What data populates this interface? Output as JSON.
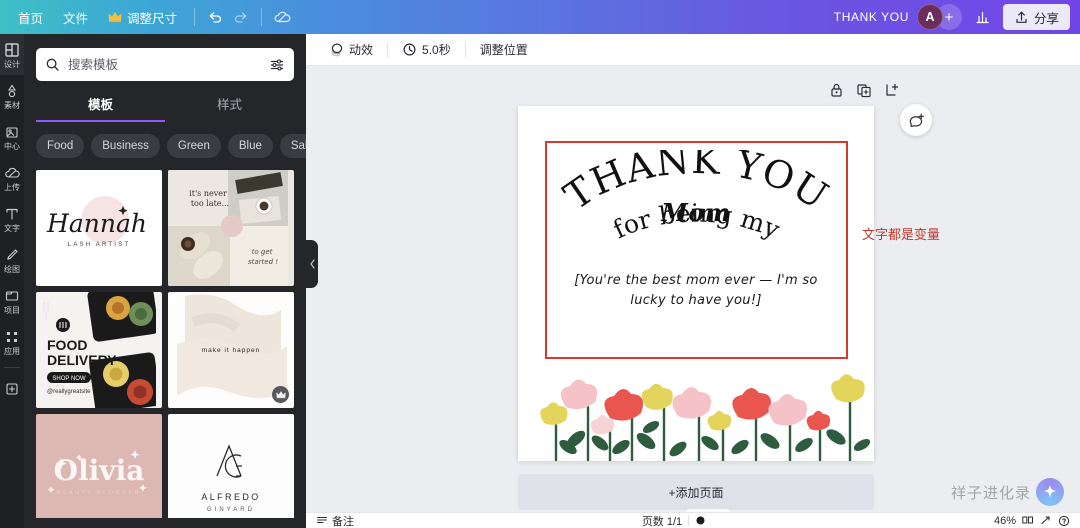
{
  "topbar": {
    "home_label": "首页",
    "file_label": "文件",
    "resize_label": "调整尺寸",
    "undo_icon": "undo-icon",
    "redo_icon": "redo-icon",
    "cloud_icon": "cloud-saved-icon",
    "doc_title": "THANK YOU",
    "avatar_initial": "A",
    "add_collaborator": "+",
    "insights_icon": "chart-icon",
    "share_label": "分享",
    "share_icon": "upload-icon",
    "gradient_start": "#3fc0c6",
    "gradient_end": "#7146e8"
  },
  "rail": {
    "items": [
      {
        "label": "设计",
        "icon": "design-icon",
        "active": true
      },
      {
        "label": "素材",
        "icon": "elements-icon",
        "active": false
      },
      {
        "label": "中心",
        "icon": "brand-center-icon",
        "active": false
      },
      {
        "label": "上传",
        "icon": "upload-cloud-icon",
        "active": false
      },
      {
        "label": "文字",
        "icon": "text-icon",
        "active": false
      },
      {
        "label": "绘图",
        "icon": "draw-icon",
        "active": false
      },
      {
        "label": "项目",
        "icon": "projects-icon",
        "active": false
      },
      {
        "label": "应用",
        "icon": "apps-icon",
        "active": false
      }
    ],
    "more_icon": "add-more-icon"
  },
  "panel": {
    "search_placeholder": "搜索模板",
    "search_value": "",
    "search_icon": "search-icon",
    "filter_icon": "filter-sliders-icon",
    "tabs": [
      {
        "label": "模板",
        "active": true
      },
      {
        "label": "样式",
        "active": false
      }
    ],
    "chips": [
      "Food",
      "Business",
      "Green",
      "Blue",
      "Sale"
    ],
    "chip_next_icon": "chevron-right-icon",
    "templates": [
      {
        "id": "hannah",
        "title": "Hannah",
        "subtitle": "LASH ARTIST",
        "premium": false
      },
      {
        "id": "coffee",
        "title": "it's never too late...",
        "subtitle": "to get started !",
        "premium": false
      },
      {
        "id": "food",
        "title": "FOOD DELIVERY",
        "subtitle": "SHOP NOW",
        "handle": "@reallygreatsite",
        "premium": false
      },
      {
        "id": "makeit",
        "title": "make it happen",
        "subtitle": "",
        "premium": true
      },
      {
        "id": "olivia",
        "title": "Olivia",
        "subtitle": "BEAUTY BLOGGER",
        "premium": false
      },
      {
        "id": "alfredo",
        "title": "ALFREDO",
        "subtitle": "GINYARD",
        "premium": false
      }
    ],
    "collapse_icon": "chevron-left-icon"
  },
  "canvas_toolbar": {
    "animate_label": "动效",
    "animate_icon": "animate-icon",
    "duration_label": "5.0秒",
    "duration_icon": "clock-icon",
    "position_label": "调整位置"
  },
  "canvas": {
    "lock_icon": "lock-icon",
    "duplicate_icon": "duplicate-icon",
    "addpage_icon": "add-page-icon",
    "comment_icon": "add-comment-icon",
    "card": {
      "headline": "THANK YOU",
      "subline": "for being my",
      "emphasis": "Mom",
      "message": "[You're the best mom ever — I'm so lucky to have you!]",
      "border_color": "#d8392e",
      "flower_colors": {
        "pink_light": "#f5c2c7",
        "pink_pale": "#f7d3d6",
        "red": "#e8564f",
        "yellow": "#e3d45c",
        "green": "#2f5c3f"
      }
    },
    "annotation": "文字都是变量",
    "annotation_color": "#c0392b",
    "add_page_label": "+添加页面",
    "collapse_icon": "chevron-up-icon"
  },
  "statusbar": {
    "notes_label": "备注",
    "notes_icon": "notes-icon",
    "page_label": "页数 1/1",
    "timer_icon": "record-icon",
    "zoom_level": "46%",
    "grid_icon": "grid-view-icon",
    "fullscreen_icon": "fullscreen-icon",
    "help_icon": "help-icon"
  },
  "watermark": {
    "text": "祥子进化录",
    "badge_icon": "sparkle-icon"
  }
}
